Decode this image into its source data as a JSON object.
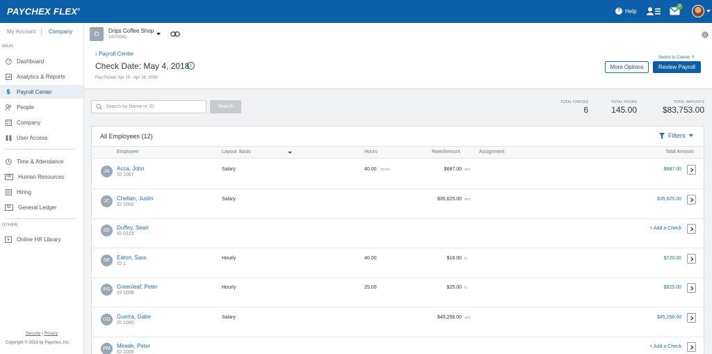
{
  "topbar": {
    "logo": "PAYCHEX FLEX",
    "logo_mark": "®",
    "help_label": "Help",
    "mail_count": "2"
  },
  "sidebar": {
    "my_account": "My Account",
    "company": "Company",
    "sections": {
      "main": "MAIN",
      "other": "OTHER"
    },
    "items": [
      {
        "label": "Dashboard",
        "icon": "dashboard-icon"
      },
      {
        "label": "Analytics & Reports",
        "icon": "analytics-icon"
      },
      {
        "label": "Payroll Center",
        "icon": "dollar-icon",
        "active": true
      },
      {
        "label": "People",
        "icon": "people-icon"
      },
      {
        "label": "Company",
        "icon": "building-icon"
      },
      {
        "label": "User Access",
        "icon": "user-access-icon"
      },
      {
        "label": "Time & Attendance",
        "icon": "clock-icon"
      },
      {
        "label": "Human Resources",
        "icon": "hr-icon",
        "badge": "HR"
      },
      {
        "label": "Hiring",
        "icon": "hiring-icon"
      },
      {
        "label": "General Ledger",
        "icon": "gl-icon",
        "badge": "GL"
      },
      {
        "label": "Online HR Library",
        "icon": "library-icon"
      }
    ],
    "footer": {
      "security": "Security",
      "sep": "|",
      "privacy": "Privacy",
      "copyright": "Copyright © 2018 by Paychex, Inc."
    }
  },
  "header": {
    "company_initial": "D",
    "company_name": "Drips Coffee Shop",
    "company_id": "14078342",
    "back_link": "Payroll Center",
    "check_date": "Check Date: May 4, 2018",
    "pay_period": "Pay Period:  Apr 15 - Apr 28, 2018",
    "switch_classic": "Switch to Classic",
    "more_options": "More Options",
    "review_payroll": "Review Payroll"
  },
  "search": {
    "placeholder": "Search by Name or ID",
    "button": "Search"
  },
  "totals": {
    "checks_label": "TOTAL CHECKS",
    "checks": "6",
    "hours_label": "TOTAL HOURS",
    "hours": "145.00",
    "amounts_label": "TOTAL AMOUNTS",
    "amounts": "$83,753.00"
  },
  "table": {
    "title": "All Employees (12)",
    "filters": "Filters",
    "columns": {
      "employee": "Employee",
      "layout": "Layout: Basic",
      "hours": "Hours",
      "rate": "Rate/Amount",
      "assignment": "Assignment",
      "total": "Total Amount"
    },
    "rows": [
      {
        "initials": "JA",
        "name": "Acca, John",
        "id": "ID 1007",
        "layout": "Salary",
        "hours": "40.00",
        "hours_unit": "memo",
        "rate": "$687.00",
        "rate_unit": "amt",
        "total": "$687.00"
      },
      {
        "initials": "JC",
        "name": "Chelian, Justin",
        "id": "ID 1002",
        "layout": "Salary",
        "hours": "",
        "hours_unit": "",
        "rate": "$35,625.00",
        "rate_unit": "amt",
        "total": "$35,625.00"
      },
      {
        "initials": "SD",
        "name": "Duffey, Sean",
        "id": "ID 0123",
        "layout": "",
        "hours": "",
        "hours_unit": "",
        "rate": "",
        "rate_unit": "",
        "total": "+ Add a Check"
      },
      {
        "initials": "SE",
        "name": "Eaton, Sara",
        "id": "ID 1",
        "layout": "Hourly",
        "hours": "40.00",
        "hours_unit": "",
        "rate": "$18.00",
        "rate_unit": "hr",
        "total": "$720.00"
      },
      {
        "initials": "PG",
        "name": "Greenleaf, Peter",
        "id": "ID 1008",
        "layout": "Hourly",
        "hours": "25.00",
        "hours_unit": "",
        "rate": "$25.00",
        "rate_unit": "hr",
        "total": "$625.00"
      },
      {
        "initials": "GG",
        "name": "Guerra, Gabe",
        "id": "ID 1000",
        "layout": "Salary",
        "hours": "",
        "hours_unit": "",
        "rate": "$45,256.00",
        "rate_unit": "amt",
        "total": "$45,256.00"
      },
      {
        "initials": "PM",
        "name": "Meade, Peter",
        "id": "ID 1009",
        "layout": "",
        "hours": "",
        "hours_unit": "",
        "rate": "",
        "rate_unit": "",
        "total": "+ Add a Check"
      }
    ]
  }
}
